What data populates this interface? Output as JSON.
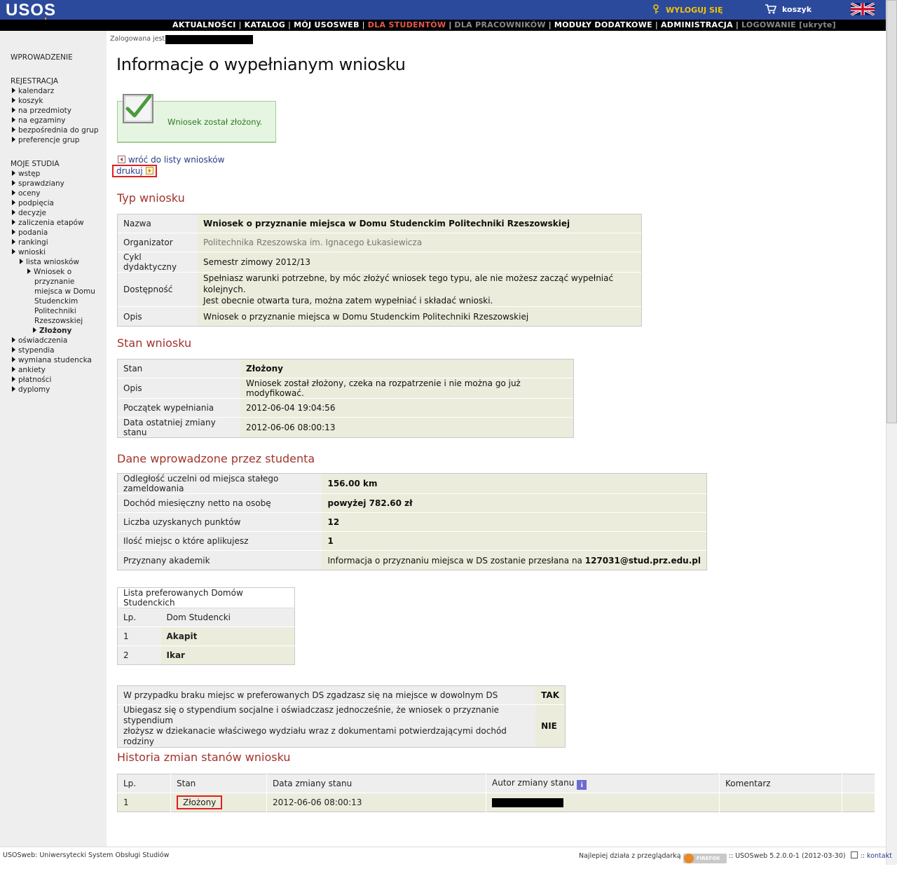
{
  "header": {
    "logo_main": "USOS",
    "logo_sub": "web",
    "logout": "WYLOGUJ SIĘ",
    "cart": "koszyk"
  },
  "nav": [
    {
      "label": "AKTUALNOŚCI",
      "state": "normal"
    },
    {
      "label": "KATALOG",
      "state": "normal"
    },
    {
      "label": "MÓJ USOSWEB",
      "state": "normal"
    },
    {
      "label": "DLA STUDENTÓW",
      "state": "active"
    },
    {
      "label": "DLA PRACOWNIKÓW",
      "state": "muted"
    },
    {
      "label": "MODUŁY DODATKOWE",
      "state": "normal"
    },
    {
      "label": "ADMINISTRACJA",
      "state": "normal"
    },
    {
      "label": "LOGOWANIE [ukryte]",
      "state": "muted"
    }
  ],
  "sidebar": {
    "intro": "WPROWADZENIE",
    "registration": {
      "title": "REJESTRACJA",
      "items": [
        "kalendarz",
        "koszyk",
        "na przedmioty",
        "na egzaminy",
        "bezpośrednia do grup",
        "preferencje grup"
      ]
    },
    "studies": {
      "title": "MOJE STUDIA",
      "items": [
        "wstęp",
        "sprawdziany",
        "oceny",
        "podpięcia",
        "decyzje",
        "zaliczenia etapów",
        "podania",
        "rankingi",
        "wnioski"
      ],
      "sub_list": "lista wniosków",
      "sub_app_lines": [
        "Wniosek o",
        "przyznanie",
        "miejsca w Domu",
        "Studenckim",
        "Politechniki",
        "Rzeszowskiej"
      ],
      "sub_status": "Złożony",
      "items_after": [
        "oświadczenia",
        "stypendia",
        "wymiana studencka",
        "ankiety",
        "płatności",
        "dyplomy"
      ]
    }
  },
  "logged_in_label": "Zalogowana jest:",
  "page_title": "Informacje o wypełnianym wniosku",
  "success_message": "Wniosek został złożony.",
  "back_link": "wróć do listy wniosków",
  "print_link": "drukuj",
  "type_section": {
    "title": "Typ wniosku",
    "rows": [
      {
        "label": "Nazwa",
        "value": "Wniosek o przyznanie miejsca w Domu Studenckim Politechniki Rzeszowskiej"
      },
      {
        "label": "Organizator",
        "value": "Politechnika Rzeszowska im. Ignacego Łukasiewicza"
      },
      {
        "label": "Cykl dydaktyczny",
        "value": "Semestr zimowy 2012/13"
      },
      {
        "label": "Dostępność",
        "value_line1": "Spełniasz warunki potrzebne, by móc złożyć wniosek tego typu, ale nie możesz zacząć wypełniać kolejnych.",
        "value_line2": "Jest obecnie otwarta tura, można zatem wypełniać i składać wnioski."
      },
      {
        "label": "Opis",
        "value": "Wniosek o przyznanie miejsca w Domu Studenckim Politechniki Rzeszowskiej"
      }
    ]
  },
  "state_section": {
    "title": "Stan wniosku",
    "rows": [
      {
        "label": "Stan",
        "value": "Złożony"
      },
      {
        "label": "Opis",
        "value": "Wniosek został złożony, czeka na rozpatrzenie i nie można go już modyfikować."
      },
      {
        "label": "Początek wypełniania",
        "value": "2012-06-04 19:04:56"
      },
      {
        "label": "Data ostatniej zmiany stanu",
        "value": "2012-06-06 08:00:13"
      }
    ]
  },
  "data_section": {
    "title": "Dane wprowadzone przez studenta",
    "rows": [
      {
        "label": "Odległość uczelni od miejsca stałego zameldowania",
        "value": "156.00 km"
      },
      {
        "label": "Dochód miesięczny netto na osobę",
        "value": "powyżej 782.60 zł"
      },
      {
        "label": "Liczba uzyskanych punktów",
        "value": "12"
      },
      {
        "label": "Ilość miejsc o które aplikujesz",
        "value": "1"
      },
      {
        "label": "Przyznany akademik",
        "value_prefix": "Informacja o przyznaniu miejsca w DS zostanie przesłana na ",
        "value_email": "127031@stud.prz.edu.pl"
      }
    ]
  },
  "preferred": {
    "caption": "Lista preferowanych Domów Studenckich",
    "col_lp": "Lp.",
    "col_ds": "Dom Studencki",
    "rows": [
      {
        "lp": "1",
        "name": "Akapit"
      },
      {
        "lp": "2",
        "name": "Ikar"
      }
    ]
  },
  "declarations": [
    {
      "line1": "W przypadku braku miejsc w preferowanych DS zgadzasz się na miejsce w dowolnym DS",
      "value": "TAK"
    },
    {
      "line1": "Ubiegasz się o stypendium socjalne i oświadczasz jednocześnie, że wniosek o przyznanie stypendium",
      "line2": "złożysz w dziekanacie właściwego wydziału wraz z dokumentami potwierdzającymi dochód rodziny",
      "value": "NIE"
    }
  ],
  "history": {
    "title": "Historia zmian stanów wniosku",
    "cols": [
      "Lp.",
      "Stan",
      "Data zmiany stanu",
      "Autor zmiany stanu",
      "Komentarz"
    ],
    "info_glyph": "i",
    "rows": [
      {
        "lp": "1",
        "status": "Złożony",
        "date": "2012-06-06 08:00:13"
      }
    ]
  },
  "footer": {
    "left": "USOSweb: Uniwersytecki System Obsługi Studiów",
    "browser_hint": "Najlepiej działa z przeglądarką",
    "badge": "FIREFOX",
    "version": ":: USOSweb 5.2.0.0-1 (2012-03-30)",
    "contact": ":: kontakt"
  },
  "colors": {
    "topbar": "#2c4a9c",
    "accent_title": "#a3332d",
    "nav_active": "#e3594c",
    "success_green": "#2b7b22",
    "highlight_red": "#e02020"
  }
}
